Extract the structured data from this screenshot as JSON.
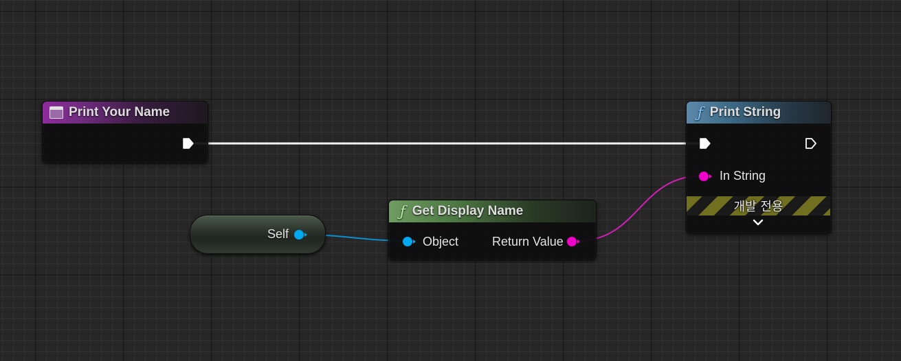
{
  "nodes": {
    "event_print_your_name": {
      "title": "Print Your Name",
      "icon": "custom-event-icon"
    },
    "get_display_name": {
      "title": "Get Display Name",
      "icon": "function-icon",
      "inputs": {
        "object": "Object"
      },
      "outputs": {
        "return_value": "Return Value"
      }
    },
    "print_string": {
      "title": "Print String",
      "icon": "function-icon",
      "inputs": {
        "in_string": "In String"
      },
      "dev_only_label": "개발 전용",
      "expand_icon": "chevron-down-icon"
    },
    "self": {
      "label": "Self"
    }
  },
  "colors": {
    "exec_wire": "#ffffff",
    "object_pin": "#00a8f0",
    "string_pin": "#f000c8",
    "event_header": "#8e2c9c",
    "function_header": "#5c8aa8",
    "pure_function_header": "#6f9c62"
  }
}
